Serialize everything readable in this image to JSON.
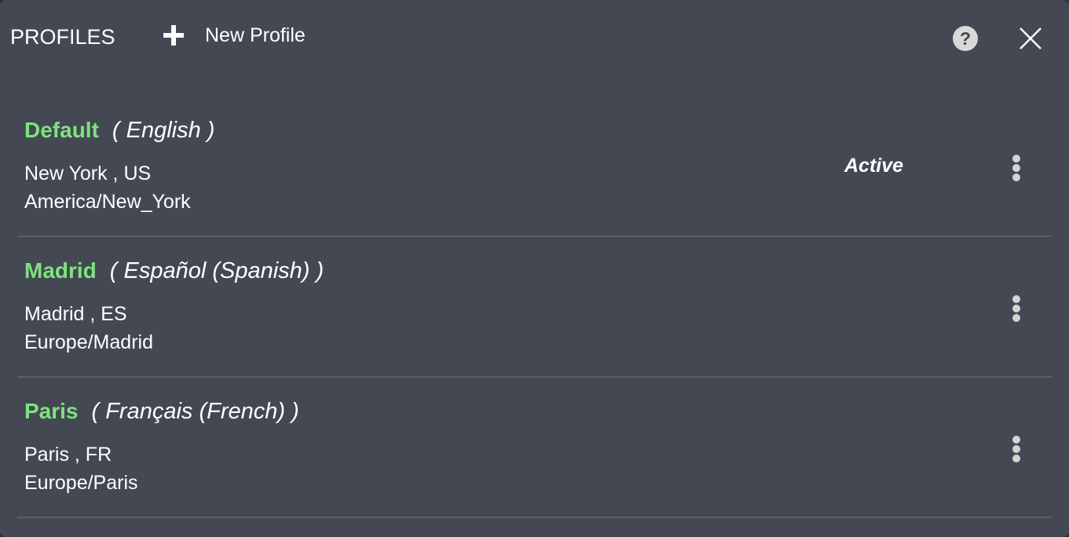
{
  "header": {
    "title": "PROFILES",
    "new_profile_label": "New Profile",
    "help_icon": "help-circle-icon",
    "close_icon": "close-icon",
    "help_glyph": "?"
  },
  "profiles": [
    {
      "name": "Default",
      "language": "( English )",
      "location": "New York ,  US",
      "timezone": "America/New_York",
      "status": "Active"
    },
    {
      "name": "Madrid",
      "language": "( Español (Spanish) )",
      "location": "Madrid ,  ES",
      "timezone": "Europe/Madrid",
      "status": ""
    },
    {
      "name": "Paris",
      "language": "( Français (French) )",
      "location": "Paris ,  FR",
      "timezone": "Europe/Paris",
      "status": ""
    }
  ],
  "colors": {
    "background": "#434852",
    "profile_name": "#7ee37e",
    "text": "#ffffff",
    "divider": "#5a5f68"
  }
}
